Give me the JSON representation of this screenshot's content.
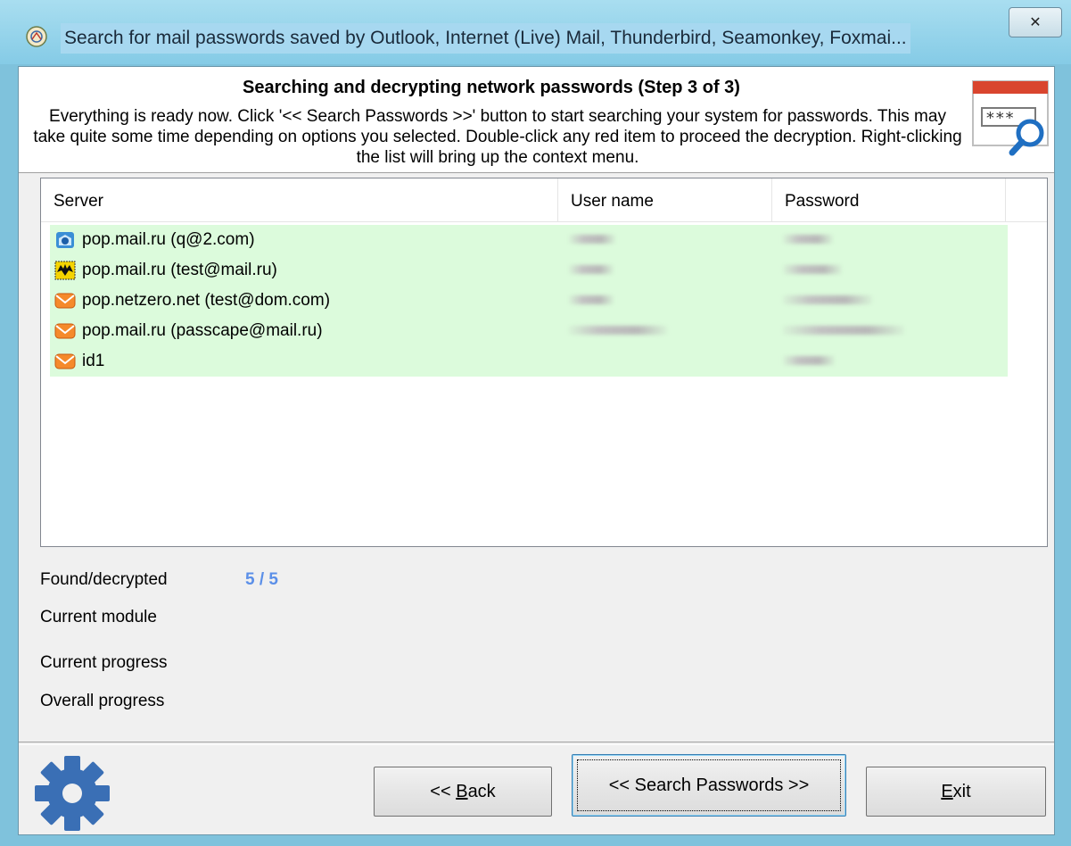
{
  "window": {
    "title": "Search for mail passwords saved by Outlook, Internet (Live) Mail, Thunderbird, Seamonkey, Foxmai...",
    "close_label": "✕"
  },
  "header": {
    "title": "Searching and decrypting network passwords (Step 3 of 3)",
    "description": "Everything is ready now. Click '<< Search Passwords >>' button to start searching your system for passwords. This may take quite some time depending on options you selected. Double-click any red item to proceed the decryption. Right-clicking the list will bring up the context menu.",
    "icon": "password-search-icon"
  },
  "list": {
    "columns": [
      "Server",
      "User name",
      "Password"
    ],
    "rows": [
      {
        "server": "pop.mail.ru (q@2.com)",
        "icon": "outlook-express-icon"
      },
      {
        "server": "pop.mail.ru (test@mail.ru)",
        "icon": "the-bat-icon"
      },
      {
        "server": "pop.netzero.net (test@dom.com)",
        "icon": "mail-envelope-icon"
      },
      {
        "server": "pop.mail.ru (passcape@mail.ru)",
        "icon": "mail-envelope-icon"
      },
      {
        "server": "id1",
        "icon": "mail-envelope-icon"
      }
    ],
    "row_color": "#dcfbdc"
  },
  "status": {
    "found_label": "Found/decrypted",
    "found_value": "5 / 5",
    "module_label": "Current module",
    "current_progress_label": "Current progress",
    "overall_progress_label": "Overall progress",
    "value_color": "#5b8fe8"
  },
  "buttons": {
    "back_prefix": "<< ",
    "back_mnemonic": "B",
    "back_rest": "ack",
    "search": "<< Search Passwords >>",
    "exit_mnemonic": "E",
    "exit_rest": "xit"
  }
}
